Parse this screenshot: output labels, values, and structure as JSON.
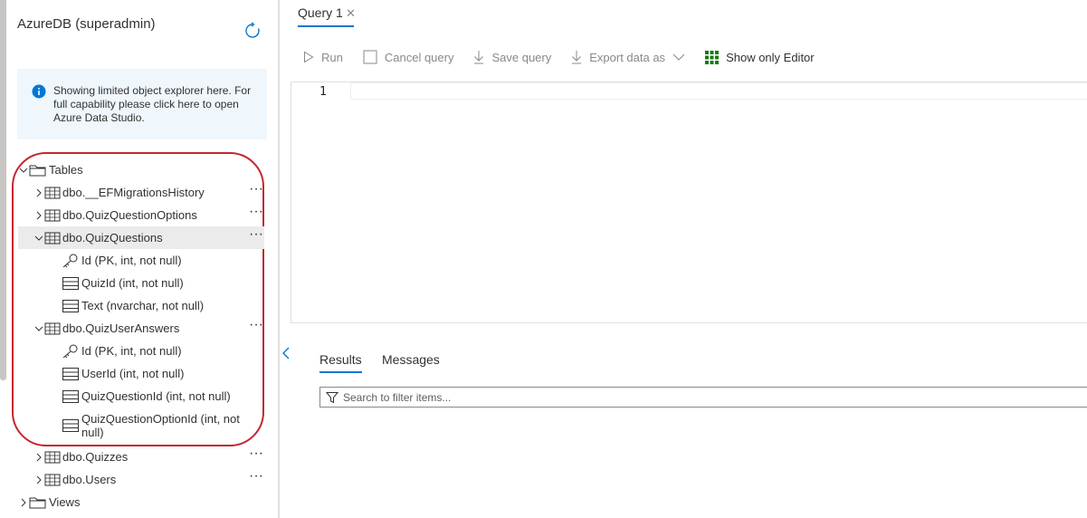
{
  "explorer": {
    "connection_title": "AzureDB (superadmin)",
    "info_message": "Showing limited object explorer here. For full capability please click here to open Azure Data Studio.",
    "tree": {
      "tables_folder": "Tables",
      "views_folder": "Views",
      "nodes": [
        {
          "label": "dbo.__EFMigrationsHistory"
        },
        {
          "label": "dbo.QuizQuestionOptions"
        },
        {
          "label": "dbo.QuizQuestions"
        },
        {
          "label": "Id (PK, int, not null)"
        },
        {
          "label": "QuizId (int, not null)"
        },
        {
          "label": "Text (nvarchar, not null)"
        },
        {
          "label": "dbo.QuizUserAnswers"
        },
        {
          "label": "Id (PK, int, not null)"
        },
        {
          "label": "UserId (int, not null)"
        },
        {
          "label": "QuizQuestionId (int, not null)"
        },
        {
          "label": "QuizQuestionOptionId (int, not null)"
        },
        {
          "label": "dbo.Quizzes"
        },
        {
          "label": "dbo.Users"
        }
      ],
      "more_glyph": "···"
    }
  },
  "query_tab": {
    "label": "Query 1",
    "close_glyph": "✕"
  },
  "toolbar": {
    "run": "Run",
    "cancel_query": "Cancel query",
    "save_query": "Save query",
    "export_data_as": "Export data as",
    "show_only_editor": "Show only Editor"
  },
  "editor": {
    "line_numbers": [
      "1"
    ]
  },
  "results": {
    "results_tab": "Results",
    "messages_tab": "Messages",
    "filter_placeholder": "Search to filter items..."
  },
  "colors": {
    "accent": "#0078d4",
    "highlight_outline": "#c4262e",
    "selected_row": "#ebebeb",
    "info_background": "#eff6fc",
    "grid_icon": "#107c10"
  },
  "icons": {
    "refresh": "refresh-icon",
    "info": "info-icon",
    "folder": "folder-icon",
    "table": "table-icon",
    "key": "key-icon",
    "column": "column-icon",
    "run": "play-icon",
    "cancel": "stop-icon",
    "save": "download-icon",
    "export": "download-icon",
    "editor_toggle": "grid-icon",
    "filter": "filter-icon"
  }
}
